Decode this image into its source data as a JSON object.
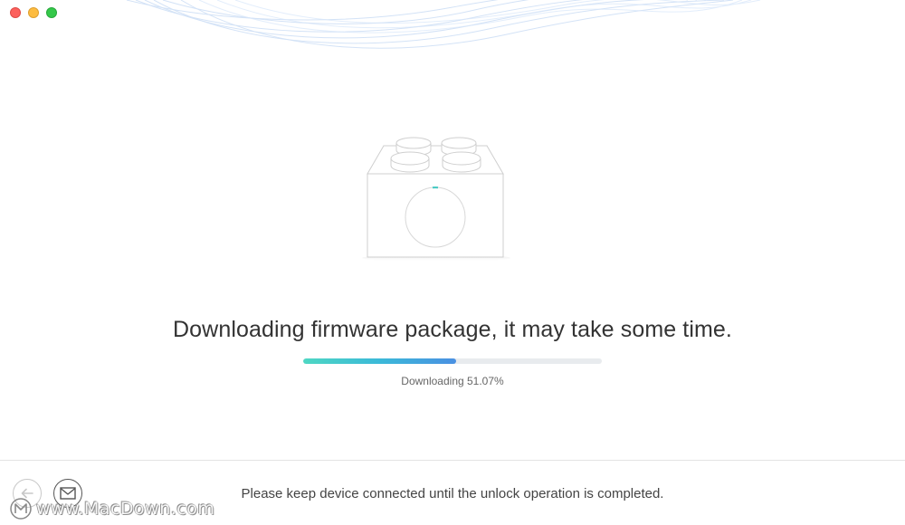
{
  "window": {
    "controls": [
      "close",
      "minimize",
      "maximize"
    ]
  },
  "device": {
    "icon": "device-brick-icon",
    "spinner": "loading-spinner-icon"
  },
  "main": {
    "message": "Downloading firmware package, it may take some time."
  },
  "progress": {
    "percent": 51.07,
    "label": "Downloading 51.07%"
  },
  "footer": {
    "message": "Please keep device connected until the unlock operation is completed.",
    "back_icon": "back-arrow-icon",
    "mail_icon": "mail-icon"
  },
  "watermark": {
    "text": "www.MacDown.com"
  },
  "colors": {
    "progress_start": "#4ed7c3",
    "progress_end": "#4a90e2",
    "track": "#e8ebee"
  }
}
